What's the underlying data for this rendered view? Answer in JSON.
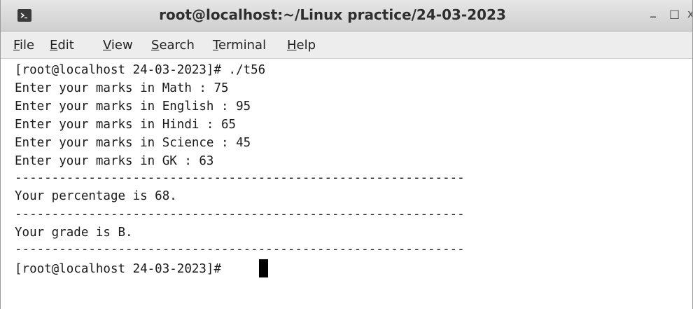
{
  "window": {
    "title": "root@localhost:~/Linux practice/24-03-2023",
    "minimize_glyph": "_",
    "maximize_glyph": "□",
    "close_glyph": "x",
    "app_icon": "terminal-icon"
  },
  "menu": [
    {
      "mnemonic": "F",
      "rest": "ile"
    },
    {
      "mnemonic": "E",
      "rest": "dit"
    },
    {
      "mnemonic": "V",
      "rest": "iew"
    },
    {
      "mnemonic": "S",
      "rest": "earch"
    },
    {
      "mnemonic": "T",
      "rest": "erminal"
    },
    {
      "mnemonic": "H",
      "rest": "elp"
    }
  ],
  "terminal": {
    "lines": [
      "[root@localhost 24-03-2023]# ./t56",
      "Enter your marks in Math : 75",
      "Enter your marks in English : 95",
      "Enter your marks in Hindi : 65",
      "Enter your marks in Science : 45",
      "Enter your marks in GK : 63",
      "-------------------------------------------------------------",
      "Your percentage is 68.",
      "-------------------------------------------------------------",
      "Your grade is B.",
      "-------------------------------------------------------------",
      "[root@localhost 24-03-2023]# "
    ]
  }
}
